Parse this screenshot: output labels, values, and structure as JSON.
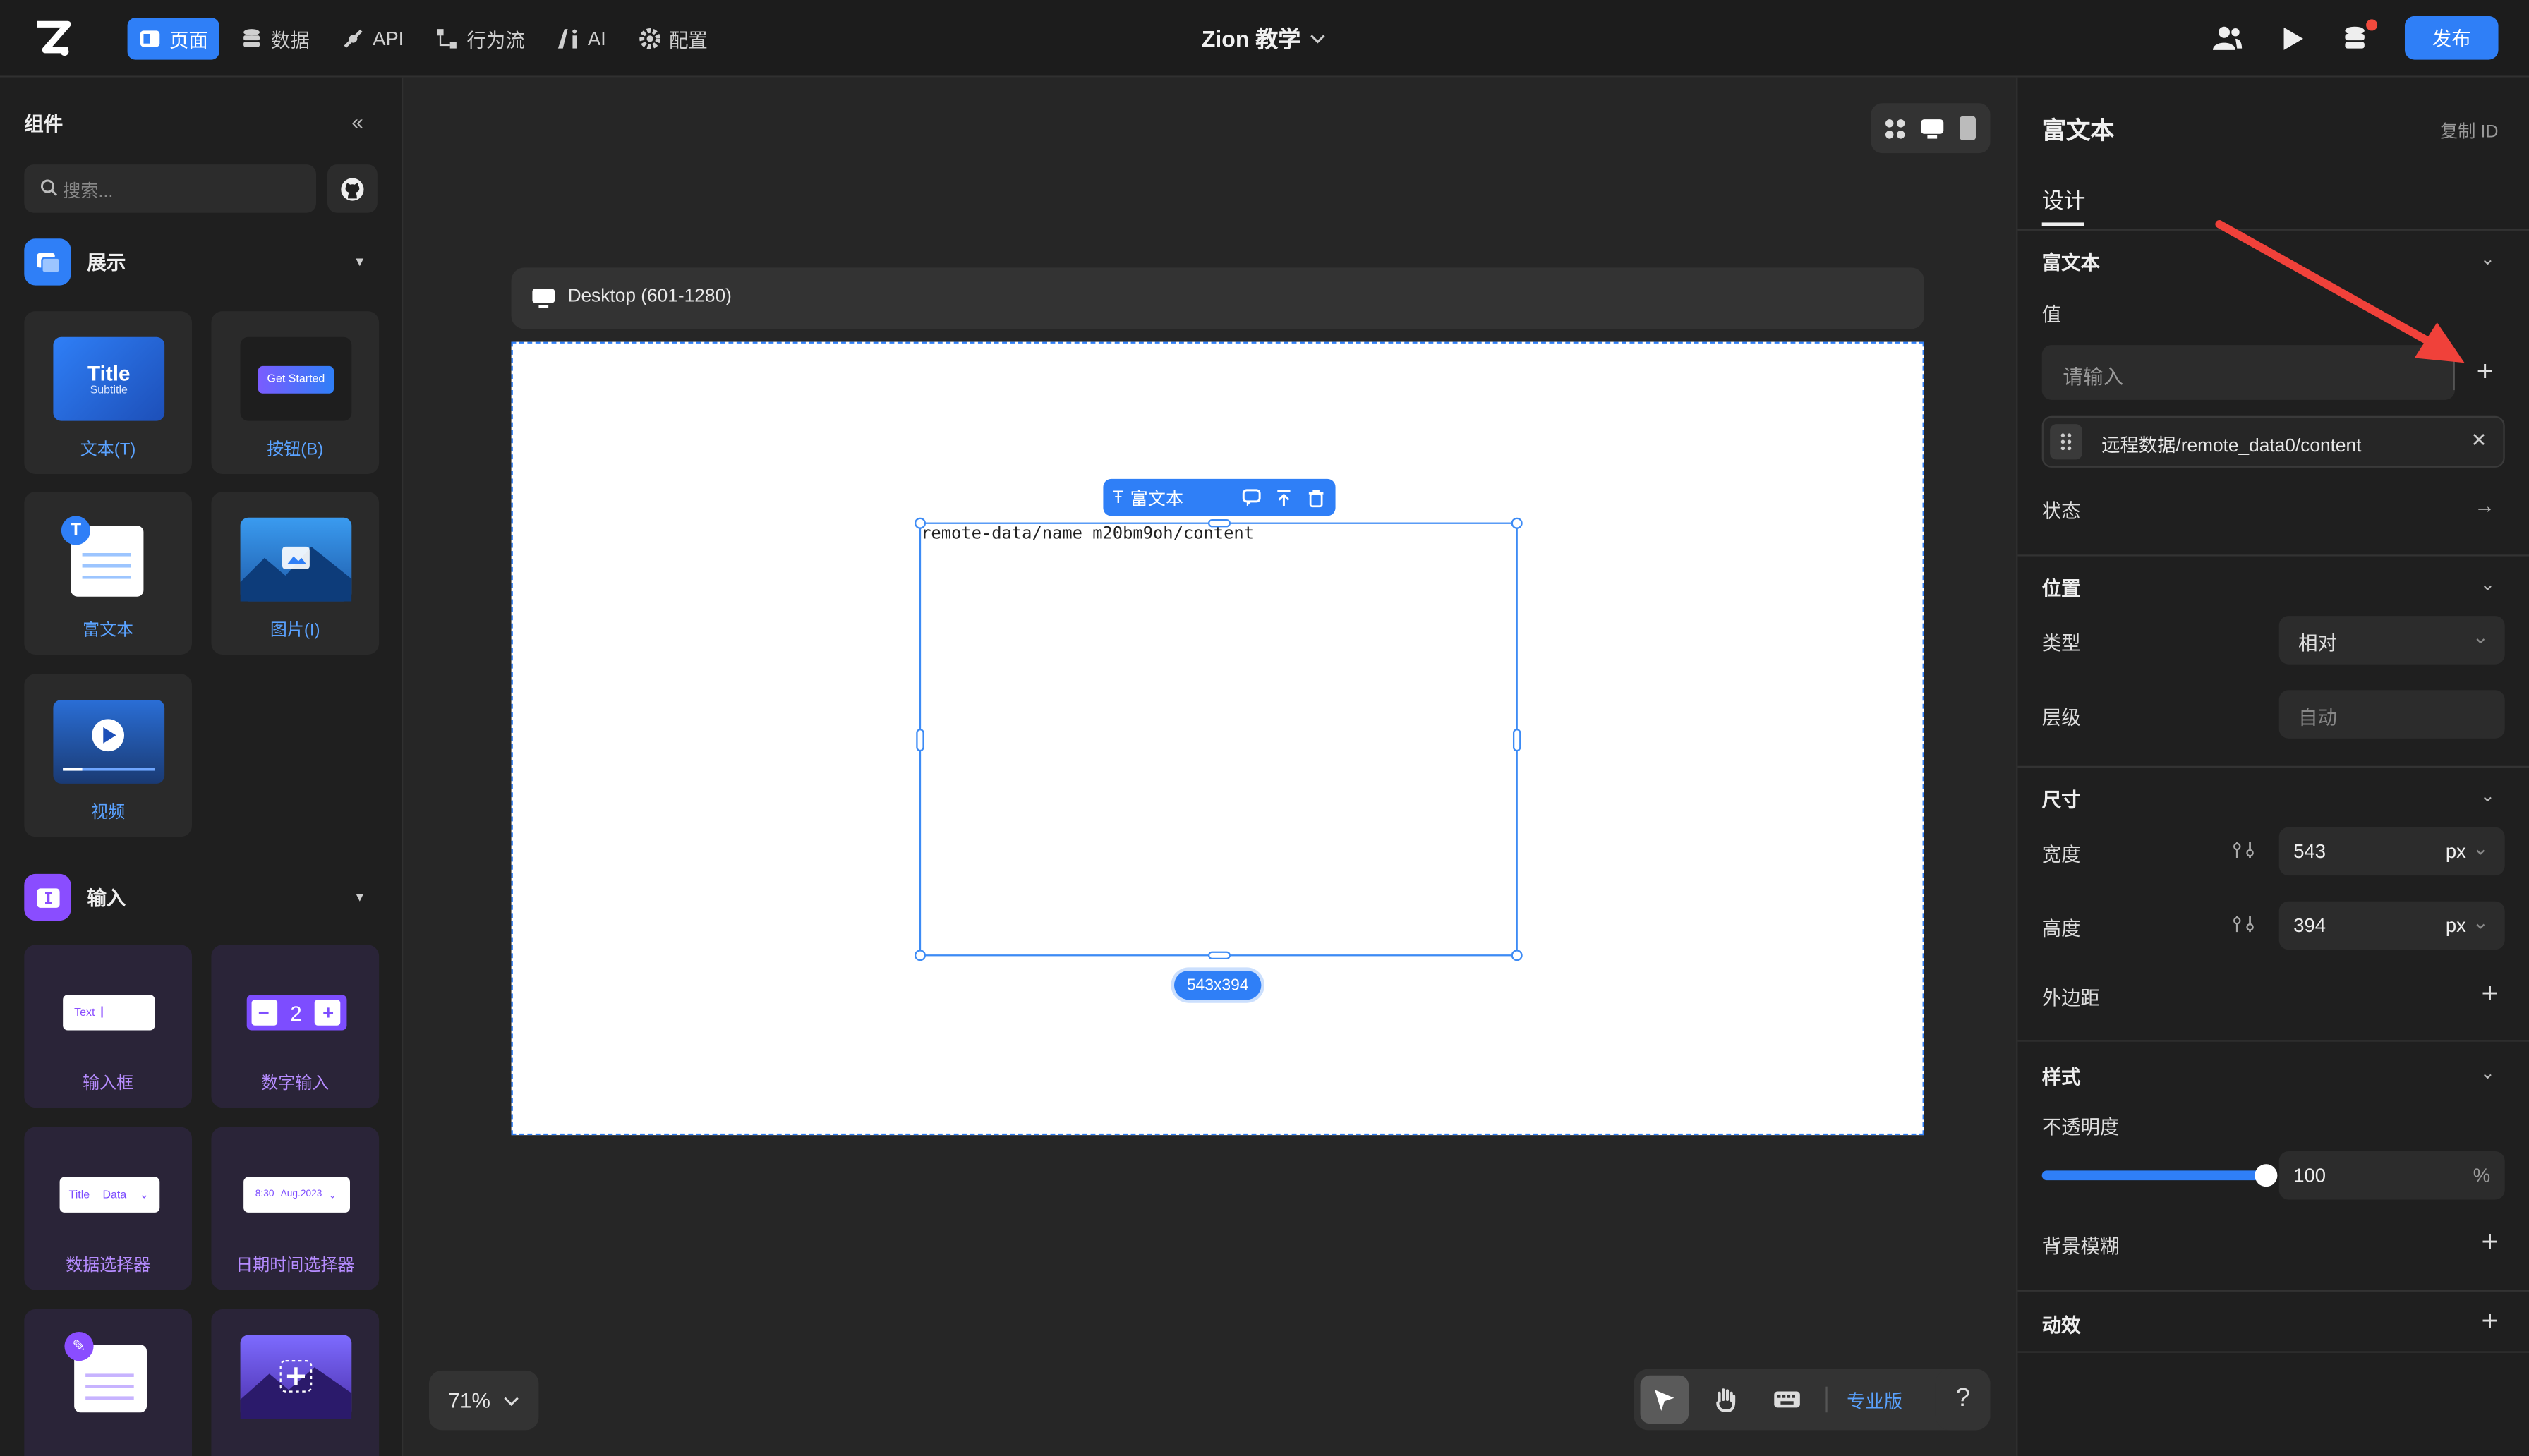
{
  "topbar": {
    "nav": [
      {
        "label": "页面",
        "icon": "page-icon",
        "active": true
      },
      {
        "label": "数据",
        "icon": "database-icon"
      },
      {
        "label": "API",
        "icon": "api-icon"
      },
      {
        "label": "行为流",
        "icon": "flow-icon"
      },
      {
        "label": "AI",
        "icon": "ai-icon"
      },
      {
        "label": "配置",
        "icon": "gear-icon"
      }
    ],
    "project_title": "Zion 教学",
    "publish_label": "发布",
    "accent_color": "#2f7ff7"
  },
  "left_panel": {
    "title": "组件",
    "search_placeholder": "搜索...",
    "category_display": "展示",
    "category_input": "输入",
    "cards": {
      "text": {
        "label": "文本(T)",
        "thumb_title": "Title",
        "thumb_sub": "Subtitle"
      },
      "button": {
        "label": "按钮(B)",
        "thumb_text": "Get Started"
      },
      "richtext": {
        "label": "富文本"
      },
      "image": {
        "label": "图片(I)"
      },
      "video": {
        "label": "视频"
      },
      "input": {
        "label": "输入框",
        "thumb_text": "Text"
      },
      "number": {
        "label": "数字输入",
        "thumb_value": "2"
      },
      "dataselect": {
        "label": "数据选择器",
        "thumb_a": "Title",
        "thumb_b": "Data"
      },
      "datetime": {
        "label": "日期时间选择器",
        "thumb_a": "8:30",
        "thumb_b": "Aug.2023"
      }
    }
  },
  "canvas": {
    "breakpoint_label": "Desktop (601-1280)",
    "selected_toolbar_label": "富文本",
    "rich_text_content": "remote-data/name_m20bm9oh/content",
    "size_badge": "543x394",
    "zoom_label": "71%",
    "plan_label": "专业版",
    "help_label": "?"
  },
  "right_panel": {
    "title": "富文本",
    "copy_id_label": "复制 ID",
    "tab_design": "设计",
    "section_richtext": "富文本",
    "value_label": "值",
    "value_placeholder": "请输入",
    "bound_value": "远程数据/remote_data0/content",
    "state_label": "状态",
    "section_position": "位置",
    "type_label": "类型",
    "type_value": "相对",
    "zindex_label": "层级",
    "zindex_placeholder": "自动",
    "section_size": "尺寸",
    "width_label": "宽度",
    "width_value": "543",
    "width_unit": "px",
    "height_label": "高度",
    "height_value": "394",
    "height_unit": "px",
    "margin_label": "外边距",
    "section_style": "样式",
    "opacity_label": "不透明度",
    "opacity_value": "100",
    "opacity_unit": "%",
    "blur_label": "背景模糊",
    "section_motion": "动效"
  }
}
